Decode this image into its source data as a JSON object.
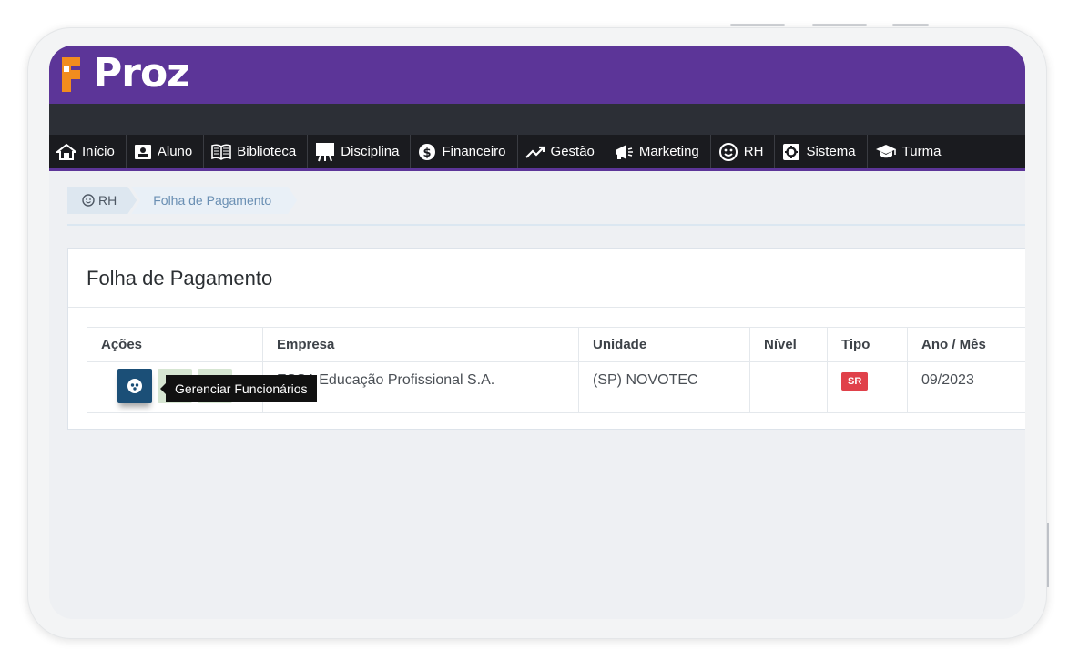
{
  "app": {
    "logo_text": "Proz",
    "brand_color": "#5c3598",
    "logo_accent": "#f28c1e"
  },
  "nav": {
    "items": [
      {
        "label": "Início",
        "icon": "home-icon"
      },
      {
        "label": "Aluno",
        "icon": "id-card-icon"
      },
      {
        "label": "Biblioteca",
        "icon": "book-icon"
      },
      {
        "label": "Disciplina",
        "icon": "easel-icon"
      },
      {
        "label": "Financeiro",
        "icon": "dollar-circle-icon"
      },
      {
        "label": "Gestão",
        "icon": "trend-line-icon"
      },
      {
        "label": "Marketing",
        "icon": "megaphone-icon"
      },
      {
        "label": "RH",
        "icon": "smiley-icon"
      },
      {
        "label": "Sistema",
        "icon": "gear-icon"
      },
      {
        "label": "Turma",
        "icon": "graduation-cap-icon"
      }
    ]
  },
  "breadcrumb": {
    "root": "RH",
    "current": "Folha de Pagamento"
  },
  "panel": {
    "title": "Folha de Pagamento"
  },
  "table": {
    "headers": [
      "Ações",
      "Empresa",
      "Unidade",
      "Nível",
      "Tipo",
      "Ano / Mês"
    ],
    "rows": [
      {
        "empresa": "ESSA Educação Profissional S.A.",
        "unidade": "(SP) NOVOTEC",
        "nivel": "",
        "tipo": "SR",
        "ano_mes": "09/2023"
      }
    ]
  },
  "tooltip": {
    "text": "Gerenciar Funcionários"
  },
  "colors": {
    "badge_red": "#e0414a",
    "action_primary": "#1b4f77",
    "action_secondary": "#d6e6d2"
  }
}
